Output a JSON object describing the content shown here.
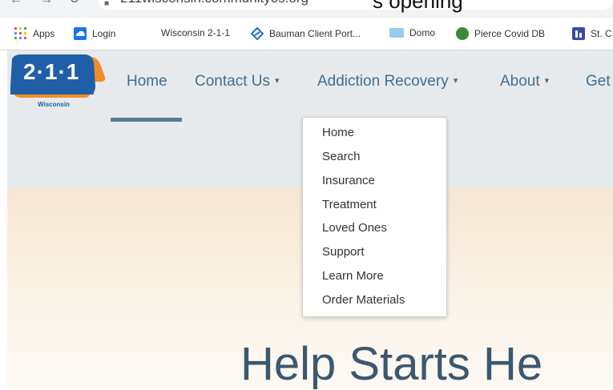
{
  "browser": {
    "url": "211wisconsin.communityos.org",
    "overlay_text": "s opening"
  },
  "bookmarks": [
    {
      "label": "Apps",
      "icon": "apps-grid-icon",
      "color": "#4285f4"
    },
    {
      "label": "Login",
      "icon": "cloud-icon",
      "color": "#1a73e8"
    },
    {
      "label": "Wisconsin 2-1-1",
      "icon": "",
      "color": ""
    },
    {
      "label": "Bauman Client Port...",
      "icon": "diamond-logo-icon",
      "color": "#1f6fc6"
    },
    {
      "label": "Domo",
      "icon": "domo-icon",
      "color": "#99ccee"
    },
    {
      "label": "Pierce Covid DB",
      "icon": "globe-icon",
      "color": "#3a8a3a"
    },
    {
      "label": "St. C",
      "icon": "bar-chart-icon",
      "color": "#3b4aa8"
    }
  ],
  "site": {
    "logo_number": "2·1·1",
    "logo_sub": "Wisconsin",
    "nav": [
      {
        "label": "Home"
      },
      {
        "label": "Contact Us",
        "caret": "▾"
      },
      {
        "label": "Addiction Recovery",
        "caret": "▾"
      },
      {
        "label": "About",
        "caret": "▾"
      },
      {
        "label": "Get"
      }
    ],
    "dropdown": [
      "Home",
      "Search",
      "Insurance",
      "Treatment",
      "Loved Ones",
      "Support",
      "Learn More",
      "Order Materials"
    ],
    "hero_title": "Help Starts He"
  },
  "colors": {
    "nav_text": "#3f6f93",
    "logo_blue": "#1f5fa8",
    "logo_orange": "#f28c28",
    "hero_text": "#3a5870"
  }
}
